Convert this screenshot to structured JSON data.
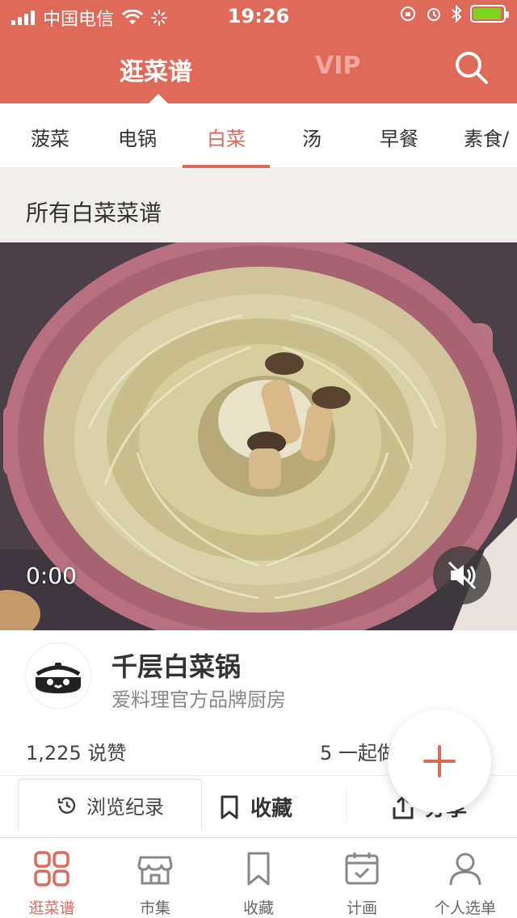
{
  "status_bar": {
    "carrier": "中国电信",
    "time": "19:26"
  },
  "top_nav": {
    "tabs": [
      "逛菜谱",
      "VIP"
    ],
    "active_tab": "逛菜谱"
  },
  "categories": {
    "items": [
      "菠菜",
      "电锅",
      "白菜",
      "汤",
      "早餐",
      "素食/"
    ],
    "active": "白菜"
  },
  "section": {
    "title": "所有白菜菜谱"
  },
  "video": {
    "time": "0:00"
  },
  "recipe": {
    "title": "千层白菜锅",
    "author": "爱料理官方品牌厨房",
    "likes": "1,225 说赞",
    "together": "5 一起做"
  },
  "actions": {
    "history": "浏览纪录",
    "favorite": "收藏",
    "share": "分享"
  },
  "tab_bar": {
    "items": [
      "逛菜谱",
      "市集",
      "收藏",
      "计画",
      "个人选单"
    ],
    "active": "逛菜谱"
  },
  "colors": {
    "brand": "#e06a5a",
    "section_bg": "#f0eeea"
  }
}
